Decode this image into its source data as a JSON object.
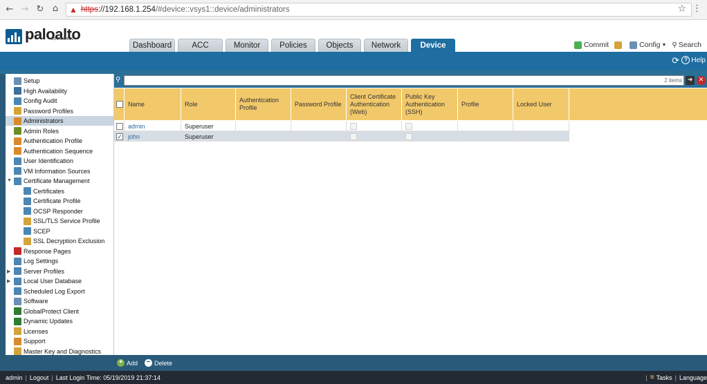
{
  "browser": {
    "url_scheme": "https",
    "url_host": "://192.168.1.254",
    "url_path": "/#device::vsys1::device/administrators"
  },
  "app": {
    "logo_text": "paloalto",
    "logo_sub": "NETWORKS",
    "tabs": [
      {
        "label": "Dashboard",
        "active": false
      },
      {
        "label": "ACC",
        "active": false
      },
      {
        "label": "Monitor",
        "active": false
      },
      {
        "label": "Policies",
        "active": false
      },
      {
        "label": "Objects",
        "active": false
      },
      {
        "label": "Network",
        "active": false
      },
      {
        "label": "Device",
        "active": true
      }
    ],
    "actions": {
      "commit": "Commit",
      "config": "Config",
      "search": "Search"
    },
    "help": "Help"
  },
  "sidebar": {
    "items": [
      {
        "label": "Setup",
        "icon": "setup-icon",
        "color": "#6a8fb5"
      },
      {
        "label": "High Availability",
        "icon": "high-availability-icon",
        "color": "#3d6e9c"
      },
      {
        "label": "Config Audit",
        "icon": "config-audit-icon",
        "color": "#4b86b4"
      },
      {
        "label": "Password Profiles",
        "icon": "password-profiles-icon",
        "color": "#d4a43a"
      },
      {
        "label": "Administrators",
        "icon": "administrators-icon",
        "color": "#d98a2b",
        "selected": true
      },
      {
        "label": "Admin Roles",
        "icon": "admin-roles-icon",
        "color": "#6b8e23"
      },
      {
        "label": "Authentication Profile",
        "icon": "authentication-profile-icon",
        "color": "#d98a2b"
      },
      {
        "label": "Authentication Sequence",
        "icon": "authentication-sequence-icon",
        "color": "#d98a2b"
      },
      {
        "label": "User Identification",
        "icon": "user-identification-icon",
        "color": "#4b86b4"
      },
      {
        "label": "VM Information Sources",
        "icon": "vm-information-sources-icon",
        "color": "#4b86b4"
      },
      {
        "label": "Certificate Management",
        "icon": "certificate-management-icon",
        "color": "#4b86b4",
        "expanded": true
      },
      {
        "label": "Certificates",
        "icon": "certificates-icon",
        "color": "#4b86b4",
        "child": true
      },
      {
        "label": "Certificate Profile",
        "icon": "certificate-profile-icon",
        "color": "#4b86b4",
        "child": true
      },
      {
        "label": "OCSP Responder",
        "icon": "ocsp-responder-icon",
        "color": "#4b86b4",
        "child": true
      },
      {
        "label": "SSL/TLS Service Profile",
        "icon": "ssl-tls-service-profile-icon",
        "color": "#d4a43a",
        "child": true
      },
      {
        "label": "SCEP",
        "icon": "scep-icon",
        "color": "#4b86b4",
        "child": true
      },
      {
        "label": "SSL Decryption Exclusion",
        "icon": "ssl-decryption-exclusion-icon",
        "color": "#d4a43a",
        "child": true
      },
      {
        "label": "Response Pages",
        "icon": "response-pages-icon",
        "color": "#c62828"
      },
      {
        "label": "Log Settings",
        "icon": "log-settings-icon",
        "color": "#4b86b4"
      },
      {
        "label": "Server Profiles",
        "icon": "server-profiles-icon",
        "color": "#4b86b4",
        "collapsed": true
      },
      {
        "label": "Local User Database",
        "icon": "local-user-database-icon",
        "color": "#4b86b4",
        "collapsed": true
      },
      {
        "label": "Scheduled Log Export",
        "icon": "scheduled-log-export-icon",
        "color": "#4b86b4"
      },
      {
        "label": "Software",
        "icon": "software-icon",
        "color": "#6a8fb5"
      },
      {
        "label": "GlobalProtect Client",
        "icon": "globalprotect-client-icon",
        "color": "#2e7d32"
      },
      {
        "label": "Dynamic Updates",
        "icon": "dynamic-updates-icon",
        "color": "#2e7d32"
      },
      {
        "label": "Licenses",
        "icon": "licenses-icon",
        "color": "#d4a43a"
      },
      {
        "label": "Support",
        "icon": "support-icon",
        "color": "#d98a2b"
      },
      {
        "label": "Master Key and Diagnostics",
        "icon": "master-key-icon",
        "color": "#d4a43a"
      }
    ]
  },
  "filter": {
    "placeholder": "",
    "items_count": "2 items"
  },
  "table": {
    "columns": [
      "Name",
      "Role",
      "Authentication Profile",
      "Password Profile",
      "Client Certificate Authentication (Web)",
      "Public Key Authentication (SSH)",
      "Profile",
      "Locked User"
    ],
    "rows": [
      {
        "name": "admin",
        "role": "Superuser",
        "checked": false,
        "selected": false
      },
      {
        "name": "john",
        "role": "Superuser",
        "checked": true,
        "selected": true
      }
    ]
  },
  "toolbar": {
    "add": "Add",
    "delete": "Delete"
  },
  "status": {
    "user": "admin",
    "logout": "Logout",
    "last_login": "Last Login Time: 05/19/2019 21:37:14",
    "tasks": "Tasks",
    "language": "Language"
  },
  "colors": {
    "brand_blue": "#1e6ea1",
    "header_gold": "#f2c96a",
    "status_bar": "#232a33"
  }
}
